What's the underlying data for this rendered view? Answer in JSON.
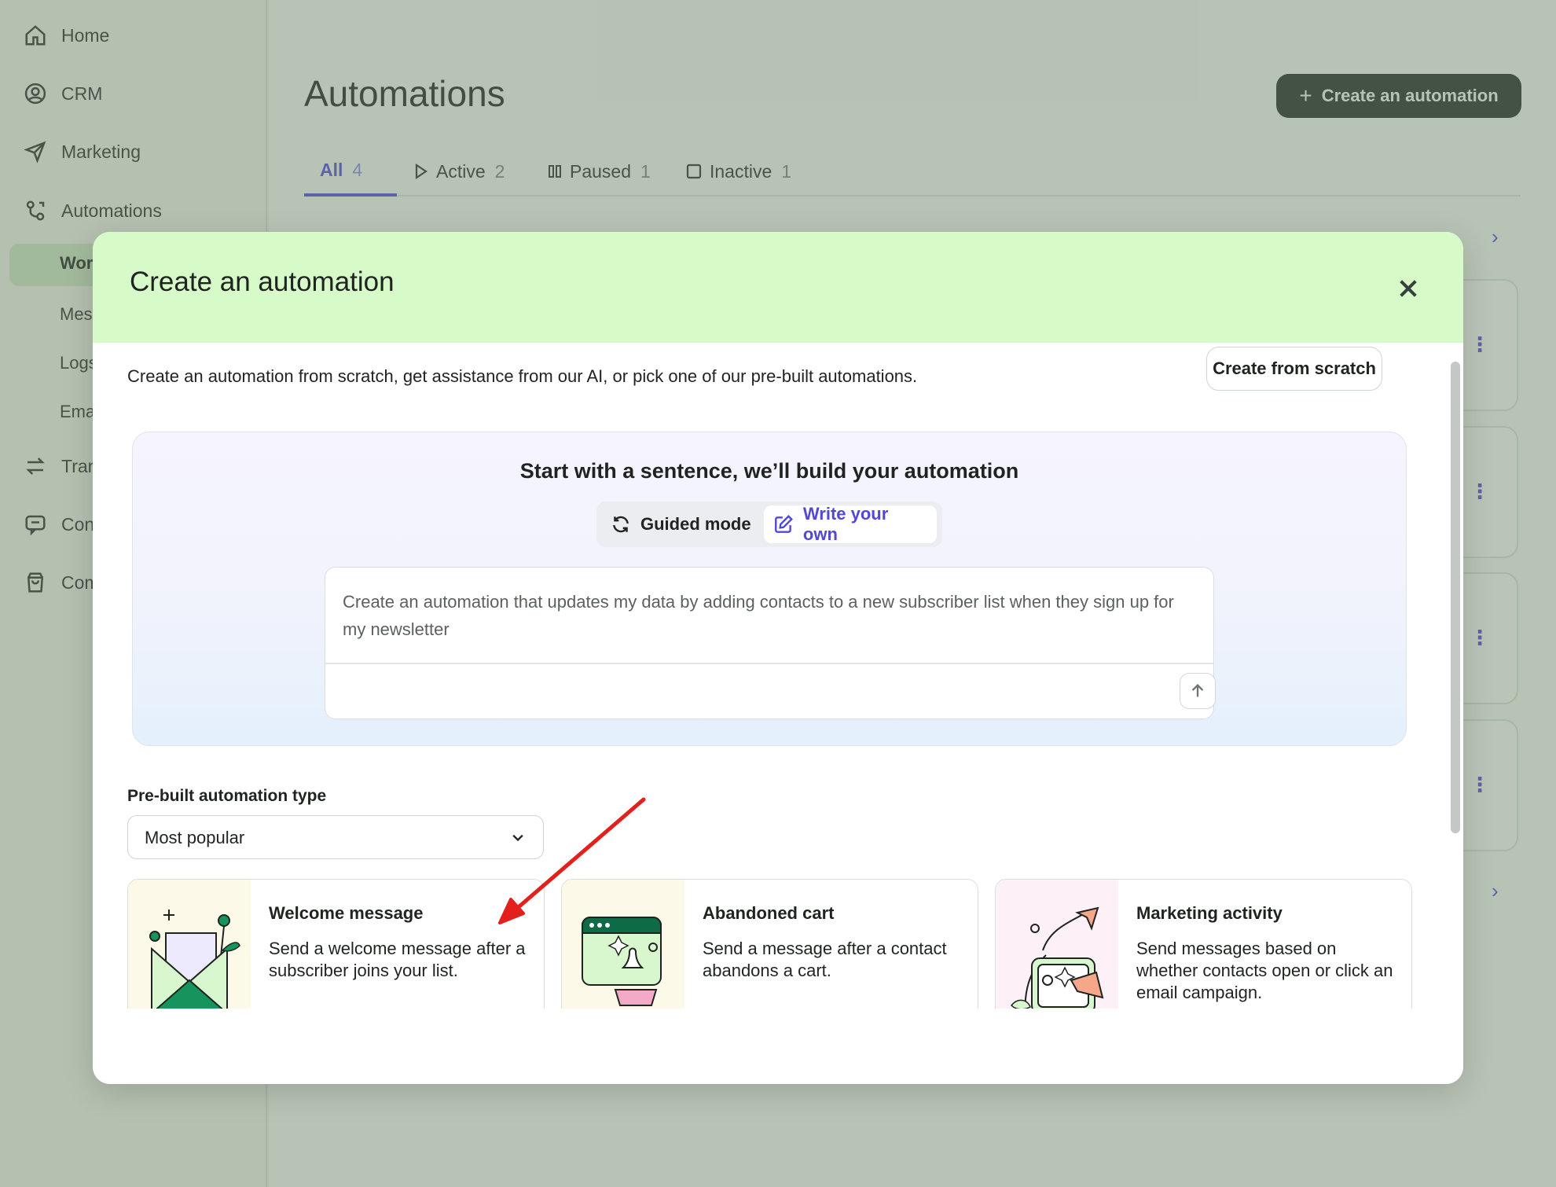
{
  "sidebar": {
    "items": [
      {
        "label": "Home",
        "icon": "home-icon"
      },
      {
        "label": "CRM",
        "icon": "user-circle-icon"
      },
      {
        "label": "Marketing",
        "icon": "send-icon"
      },
      {
        "label": "Automations",
        "icon": "automation-icon"
      },
      {
        "label": "Tran",
        "icon": "transfer-icon"
      },
      {
        "label": "Con",
        "icon": "chat-icon"
      },
      {
        "label": "Com",
        "icon": "shopping-bag-icon"
      }
    ],
    "sub_items": [
      "Wor",
      "Mes",
      "Logs",
      "Ema"
    ]
  },
  "page": {
    "title": "Automations",
    "create_button": "Create an automation",
    "tabs": [
      {
        "label": "All",
        "count": "4"
      },
      {
        "label": "Active",
        "count": "2"
      },
      {
        "label": "Paused",
        "count": "1"
      },
      {
        "label": "Inactive",
        "count": "1"
      }
    ]
  },
  "modal": {
    "title": "Create an automation",
    "intro": "Create an automation from scratch, get assistance from our AI, or pick one of our pre-built automations.",
    "scratch_button": "Create from scratch",
    "ai": {
      "title": "Start with a sentence, we’ll build your automation",
      "mode_guided": "Guided mode",
      "mode_write": "Write your own",
      "prompt": "Create an automation that updates my data by adding contacts to a new subscriber list when they sign up for my newsletter"
    },
    "prebuilt": {
      "label": "Pre-built automation type",
      "selected": "Most popular",
      "cards": [
        {
          "title": "Welcome message",
          "desc": "Send a welcome message after a subscriber joins your list."
        },
        {
          "title": "Abandoned cart",
          "desc": "Send a message after a contact abandons a cart."
        },
        {
          "title": "Marketing activity",
          "desc": "Send messages based on whether contacts open or click an email campaign."
        }
      ]
    }
  },
  "colors": {
    "accent": "#5147d8",
    "header_green": "#d6fbc8",
    "annotation_red": "#e3201b"
  }
}
